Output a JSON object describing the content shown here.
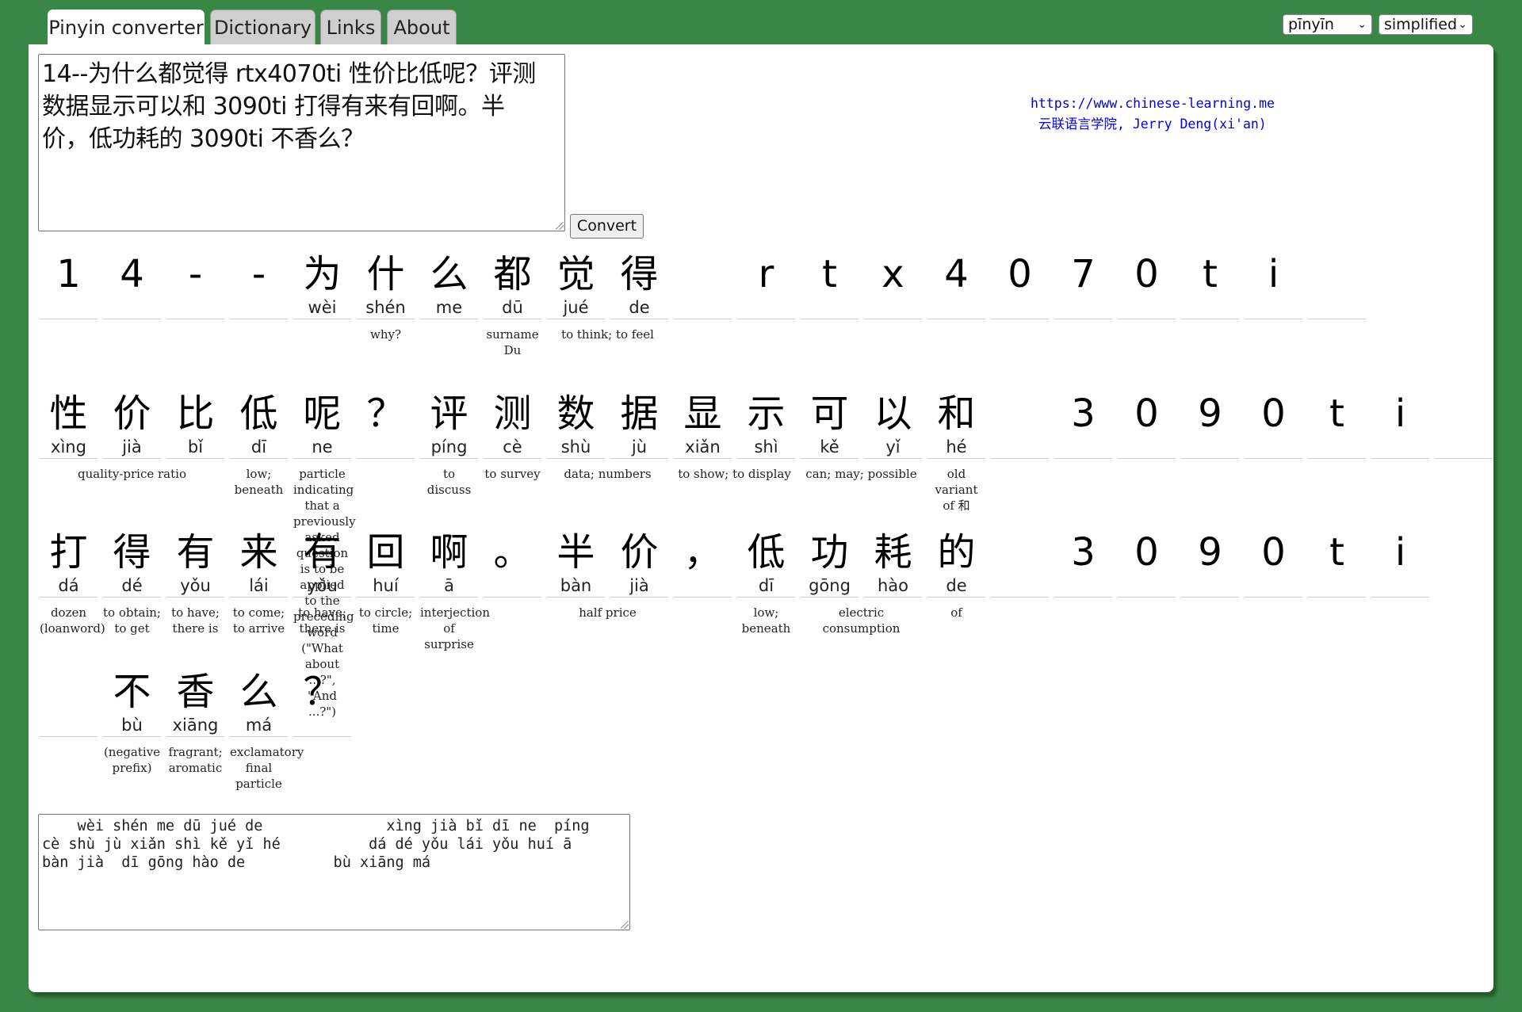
{
  "tabs": [
    {
      "label": "Pinyin converter",
      "active": true
    },
    {
      "label": "Dictionary"
    },
    {
      "label": "Links"
    },
    {
      "label": "About"
    }
  ],
  "controls": {
    "romanization": "pīnyīn",
    "script": "simplified"
  },
  "input_text": "14--为什么都觉得 rtx4070ti 性价比低呢？评测\n数据显示可以和 3090ti 打得有来有回啊。半\n价，低功耗的 3090ti 不香么？",
  "convert_label": "Convert",
  "site": {
    "url": "https://www.chinese-learning.me",
    "credit": "云联语言学院, Jerry Deng(xi'an)"
  },
  "rows": [
    {
      "cells": [
        {
          "ch": "1",
          "py": ""
        },
        {
          "ch": "4",
          "py": ""
        },
        {
          "ch": "-",
          "py": ""
        },
        {
          "ch": "-",
          "py": ""
        },
        {
          "ch": "为",
          "py": "wèi"
        },
        {
          "ch": "什",
          "py": "shén"
        },
        {
          "ch": "么",
          "py": "me"
        },
        {
          "ch": "都",
          "py": "dū"
        },
        {
          "ch": "觉",
          "py": "jué"
        },
        {
          "ch": "得",
          "py": "de"
        },
        {
          "ch": "",
          "py": ""
        },
        {
          "ch": "r",
          "py": ""
        },
        {
          "ch": "t",
          "py": ""
        },
        {
          "ch": "x",
          "py": ""
        },
        {
          "ch": "4",
          "py": ""
        },
        {
          "ch": "0",
          "py": ""
        },
        {
          "ch": "7",
          "py": ""
        },
        {
          "ch": "0",
          "py": ""
        },
        {
          "ch": "t",
          "py": ""
        },
        {
          "ch": "i",
          "py": ""
        },
        {
          "ch": "",
          "py": ""
        }
      ],
      "defs": [
        {
          "text": "why?",
          "start": 4,
          "span": 3
        },
        {
          "text": "surname Du",
          "start": 7,
          "span": 1
        },
        {
          "text": "to think; to feel",
          "start": 8,
          "span": 2
        }
      ]
    },
    {
      "cells": [
        {
          "ch": "性",
          "py": "xìng"
        },
        {
          "ch": "价",
          "py": "jià"
        },
        {
          "ch": "比",
          "py": "bǐ"
        },
        {
          "ch": "低",
          "py": "dī"
        },
        {
          "ch": "呢",
          "py": "ne"
        },
        {
          "ch": "？",
          "py": ""
        },
        {
          "ch": "评",
          "py": "píng"
        },
        {
          "ch": "测",
          "py": "cè"
        },
        {
          "ch": "数",
          "py": "shù"
        },
        {
          "ch": "据",
          "py": "jù"
        },
        {
          "ch": "显",
          "py": "xiǎn"
        },
        {
          "ch": "示",
          "py": "shì"
        },
        {
          "ch": "可",
          "py": "kě"
        },
        {
          "ch": "以",
          "py": "yǐ"
        },
        {
          "ch": "和",
          "py": "hé"
        },
        {
          "ch": "",
          "py": ""
        },
        {
          "ch": "3",
          "py": ""
        },
        {
          "ch": "0",
          "py": ""
        },
        {
          "ch": "9",
          "py": ""
        },
        {
          "ch": "0",
          "py": ""
        },
        {
          "ch": "t",
          "py": ""
        },
        {
          "ch": "i",
          "py": ""
        },
        {
          "ch": "",
          "py": ""
        }
      ],
      "defs": [
        {
          "text": "quality-price ratio",
          "start": 0,
          "span": 3
        },
        {
          "text": "low; beneath",
          "start": 3,
          "span": 1
        },
        {
          "text": "particle indicating that a previously asked question is to be applied to the preceding word (\"What about ...?\", \"And ...?\")",
          "start": 4,
          "span": 1
        },
        {
          "text": "to discuss",
          "start": 6,
          "span": 1
        },
        {
          "text": "to survey",
          "start": 7,
          "span": 1
        },
        {
          "text": "data; numbers",
          "start": 8,
          "span": 2
        },
        {
          "text": "to show; to display",
          "start": 10,
          "span": 2
        },
        {
          "text": "can; may; possible",
          "start": 12,
          "span": 2
        },
        {
          "text": "old variant of 和",
          "start": 14,
          "span": 1
        }
      ]
    },
    {
      "cells": [
        {
          "ch": "打",
          "py": "dá"
        },
        {
          "ch": "得",
          "py": "dé"
        },
        {
          "ch": "有",
          "py": "yǒu"
        },
        {
          "ch": "来",
          "py": "lái"
        },
        {
          "ch": "有",
          "py": "yǒu"
        },
        {
          "ch": "回",
          "py": "huí"
        },
        {
          "ch": "啊",
          "py": "ā"
        },
        {
          "ch": "。",
          "py": ""
        },
        {
          "ch": "半",
          "py": "bàn"
        },
        {
          "ch": "价",
          "py": "jià"
        },
        {
          "ch": "，",
          "py": ""
        },
        {
          "ch": "低",
          "py": "dī"
        },
        {
          "ch": "功",
          "py": "gōng"
        },
        {
          "ch": "耗",
          "py": "hào"
        },
        {
          "ch": "的",
          "py": "de"
        },
        {
          "ch": "",
          "py": ""
        },
        {
          "ch": "3",
          "py": ""
        },
        {
          "ch": "0",
          "py": ""
        },
        {
          "ch": "9",
          "py": ""
        },
        {
          "ch": "0",
          "py": ""
        },
        {
          "ch": "t",
          "py": ""
        },
        {
          "ch": "i",
          "py": ""
        }
      ],
      "defs": [
        {
          "text": "dozen (loanword)",
          "start": 0,
          "span": 1
        },
        {
          "text": "to obtain; to get",
          "start": 1,
          "span": 1
        },
        {
          "text": "to have; there is",
          "start": 2,
          "span": 1
        },
        {
          "text": "to come; to arrive",
          "start": 3,
          "span": 1
        },
        {
          "text": "to have; there is",
          "start": 4,
          "span": 1
        },
        {
          "text": "to circle; time",
          "start": 5,
          "span": 1
        },
        {
          "text": "interjection of surprise",
          "start": 6,
          "span": 1
        },
        {
          "text": "half price",
          "start": 8,
          "span": 2
        },
        {
          "text": "low; beneath",
          "start": 11,
          "span": 1
        },
        {
          "text": "electric consumption",
          "start": 12,
          "span": 2
        },
        {
          "text": "of",
          "start": 14,
          "span": 1
        }
      ]
    },
    {
      "cells": [
        {
          "ch": "",
          "py": ""
        },
        {
          "ch": "不",
          "py": "bù"
        },
        {
          "ch": "香",
          "py": "xiāng"
        },
        {
          "ch": "么",
          "py": "má"
        },
        {
          "ch": "？",
          "py": ""
        }
      ],
      "defs": [
        {
          "text": "(negative prefix)",
          "start": 1,
          "span": 1
        },
        {
          "text": "fragrant; aromatic",
          "start": 2,
          "span": 1
        },
        {
          "text": "exclamatory final particle",
          "start": 3,
          "span": 1
        }
      ]
    }
  ],
  "output_text": "    wèi shén me dū jué de              xìng jià bǐ dī ne  píng\ncè shù jù xiǎn shì kě yǐ hé          dá dé yǒu lái yǒu huí ā\nbàn jià  dī gōng hào de          bù xiāng má"
}
